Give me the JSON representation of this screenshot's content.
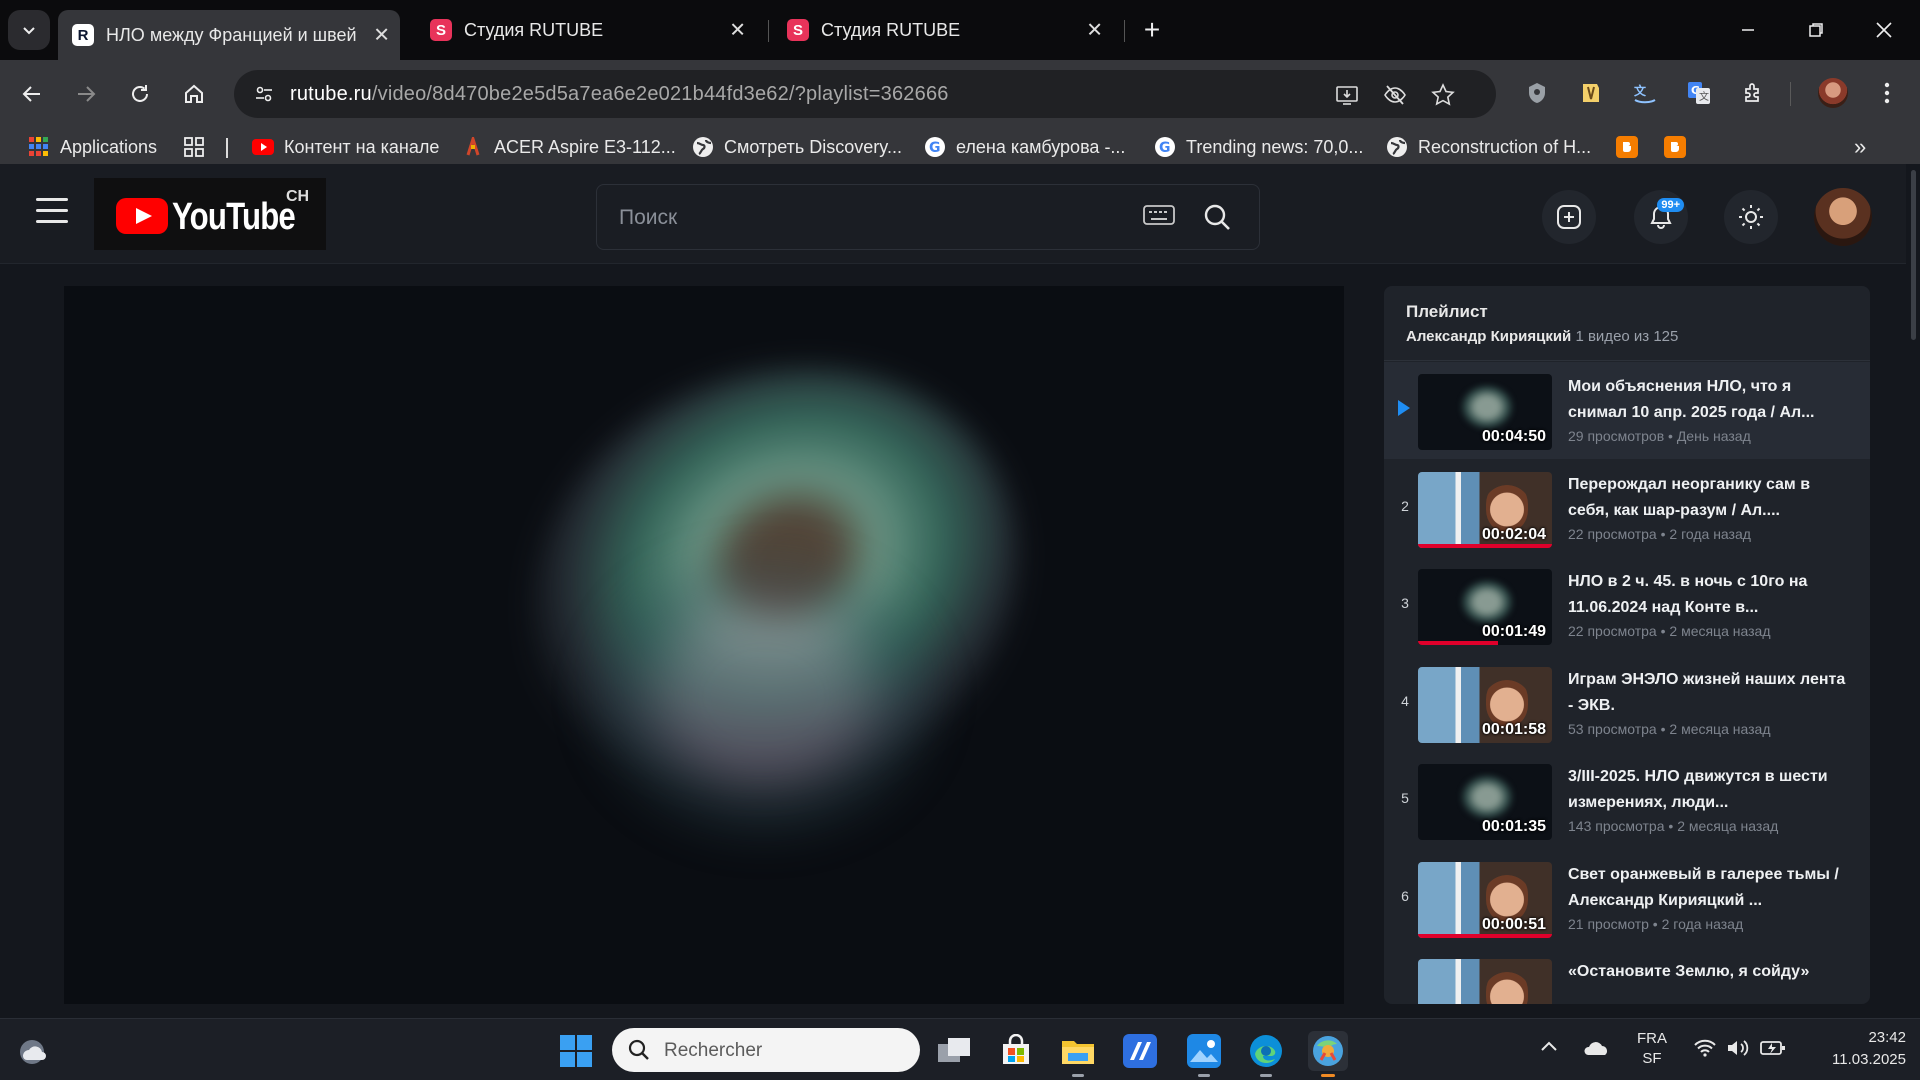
{
  "browser": {
    "tabs": [
      {
        "title": "НЛО между Францией и швейцарией",
        "favicon": "R",
        "active": true
      },
      {
        "title": "Студия RUTUBE",
        "favicon": "S",
        "active": false
      },
      {
        "title": "Студия RUTUBE",
        "favicon": "S",
        "active": false
      }
    ],
    "address": {
      "host": "rutube.ru",
      "path": "/video/8d470be2e5d5a7ea6e2e021b44fd3e62/?playlist=362666"
    },
    "bookmarks": [
      {
        "label": "Applications",
        "icon": "apps-grid-icon"
      },
      {
        "label": "Контент на канале",
        "icon": "youtube-icon"
      },
      {
        "label": "ACER Aspire E3-112...",
        "icon": "acer-icon"
      },
      {
        "label": "Смотреть Discovery...",
        "icon": "globe-icon"
      },
      {
        "label": "елена камбурова -...",
        "icon": "google-icon"
      },
      {
        "label": "Trending news: 70,0...",
        "icon": "google-icon"
      },
      {
        "label": "Reconstruction of H...",
        "icon": "globe-icon"
      }
    ]
  },
  "site": {
    "logo_text": "YouTube",
    "logo_sup": "CH",
    "search_placeholder": "Поиск",
    "notifications_badge": "99+"
  },
  "playlist": {
    "heading": "Плейлист",
    "author": "Александр Кирияцкий",
    "count": "1 видео из 125",
    "items": [
      {
        "index": "",
        "title": "Мои объяснения НЛО, что я снимал 10 апр. 2025 года / Ал...",
        "views": "29 просмотров",
        "ago": "День назад",
        "duration": "00:04:50",
        "thumb": "ufo",
        "progress": 0
      },
      {
        "index": "2",
        "title": "Перерождал неорганику сам в себя, как шар-разум / Ал....",
        "views": "22 просмотра",
        "ago": "2 года назад",
        "duration": "00:02:04",
        "thumb": "person",
        "progress": 1
      },
      {
        "index": "3",
        "title": "НЛО в 2 ч. 45. в ночь с 10го на 11.06.2024 над Конте в...",
        "views": "22 просмотра",
        "ago": "2 месяца назад",
        "duration": "00:01:49",
        "thumb": "ufo",
        "progress": 0.6
      },
      {
        "index": "4",
        "title": "Играм ЭНЭЛО жизней наших лента - ЭКВ.",
        "views": "53 просмотра",
        "ago": "2 месяца назад",
        "duration": "00:01:58",
        "thumb": "person",
        "progress": 0
      },
      {
        "index": "5",
        "title": "3/III-2025. НЛО движутся в шести измерениях, люди...",
        "views": "143 просмотра",
        "ago": "2 месяца назад",
        "duration": "00:01:35",
        "thumb": "ufo",
        "progress": 0
      },
      {
        "index": "6",
        "title": "Свет оранжевый в галерее тьмы / Александр Кирияцкий ...",
        "views": "21 просмотр",
        "ago": "2 года назад",
        "duration": "00:00:51",
        "thumb": "person",
        "progress": 1
      },
      {
        "index": "",
        "title": "«Остановите Землю, я сойду»",
        "views": "",
        "ago": "",
        "duration": "",
        "thumb": "person",
        "progress": 0
      }
    ]
  },
  "taskbar": {
    "search_placeholder": "Rechercher",
    "lang": "FRA",
    "layout": "SF",
    "time": "23:42",
    "date": "11.03.2025"
  }
}
